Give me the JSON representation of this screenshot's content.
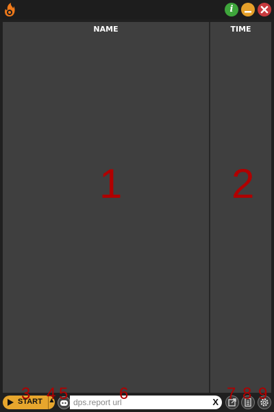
{
  "window": {
    "logo_icon": "flame-logo-icon",
    "info_label": "i",
    "minimize_label": "–",
    "close_label": "✕",
    "colors": {
      "info": "#3ea53b",
      "minimize": "#e5a02a",
      "close": "#c73a3e",
      "accent": "#e7a62d"
    }
  },
  "table": {
    "columns": [
      "NAME",
      "TIME"
    ]
  },
  "annotations": {
    "name_area": "1",
    "time_area": "2",
    "start_button": "3",
    "start_dropdown": "4",
    "discord_button": "5",
    "url_field": "6",
    "open_button": "7",
    "log_button": "8",
    "settings_button": "9"
  },
  "toolbar": {
    "start_label": "START",
    "dropdown_icon": "caret-up-icon",
    "discord_icon": "discord-icon",
    "url_placeholder": "dps.report url",
    "url_value": "",
    "clear_label": "X",
    "open_icon": "external-link-icon",
    "log_icon": "document-icon",
    "settings_icon": "gear-icon"
  }
}
